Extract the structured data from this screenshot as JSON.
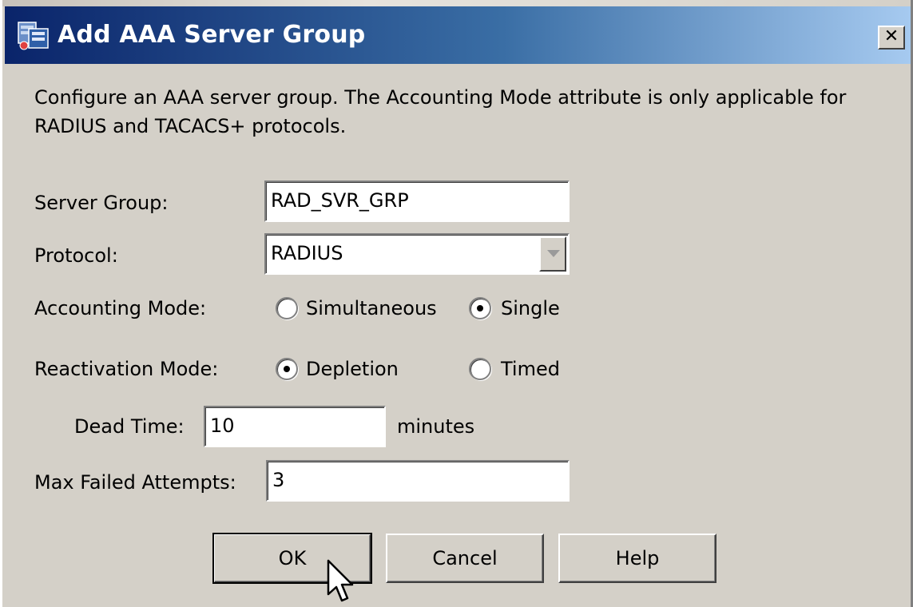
{
  "window": {
    "title": "Add AAA Server Group",
    "close_glyph": "✕",
    "icon": "aaa-server-group-icon"
  },
  "description": "Configure an AAA server group. The Accounting Mode attribute is only applicable for RADIUS and TACACS+ protocols.",
  "form": {
    "server_group": {
      "label": "Server Group:",
      "value": "RAD_SVR_GRP"
    },
    "protocol": {
      "label": "Protocol:",
      "value": "RADIUS"
    },
    "accounting_mode": {
      "label": "Accounting Mode:",
      "options": [
        {
          "label": "Simultaneous",
          "checked": false
        },
        {
          "label": "Single",
          "checked": true
        }
      ]
    },
    "reactivation_mode": {
      "label": "Reactivation Mode:",
      "options": [
        {
          "label": "Depletion",
          "checked": true
        },
        {
          "label": "Timed",
          "checked": false
        }
      ]
    },
    "dead_time": {
      "label": "Dead Time:",
      "value": "10",
      "unit": "minutes"
    },
    "max_failed_attempts": {
      "label": "Max Failed Attempts:",
      "value": "3"
    }
  },
  "buttons": {
    "ok": "OK",
    "cancel": "Cancel",
    "help": "Help"
  },
  "colors": {
    "title_gradient_start": "#0a246a",
    "title_gradient_end": "#a6caf0",
    "dialog_bg": "#d4d0c8"
  }
}
